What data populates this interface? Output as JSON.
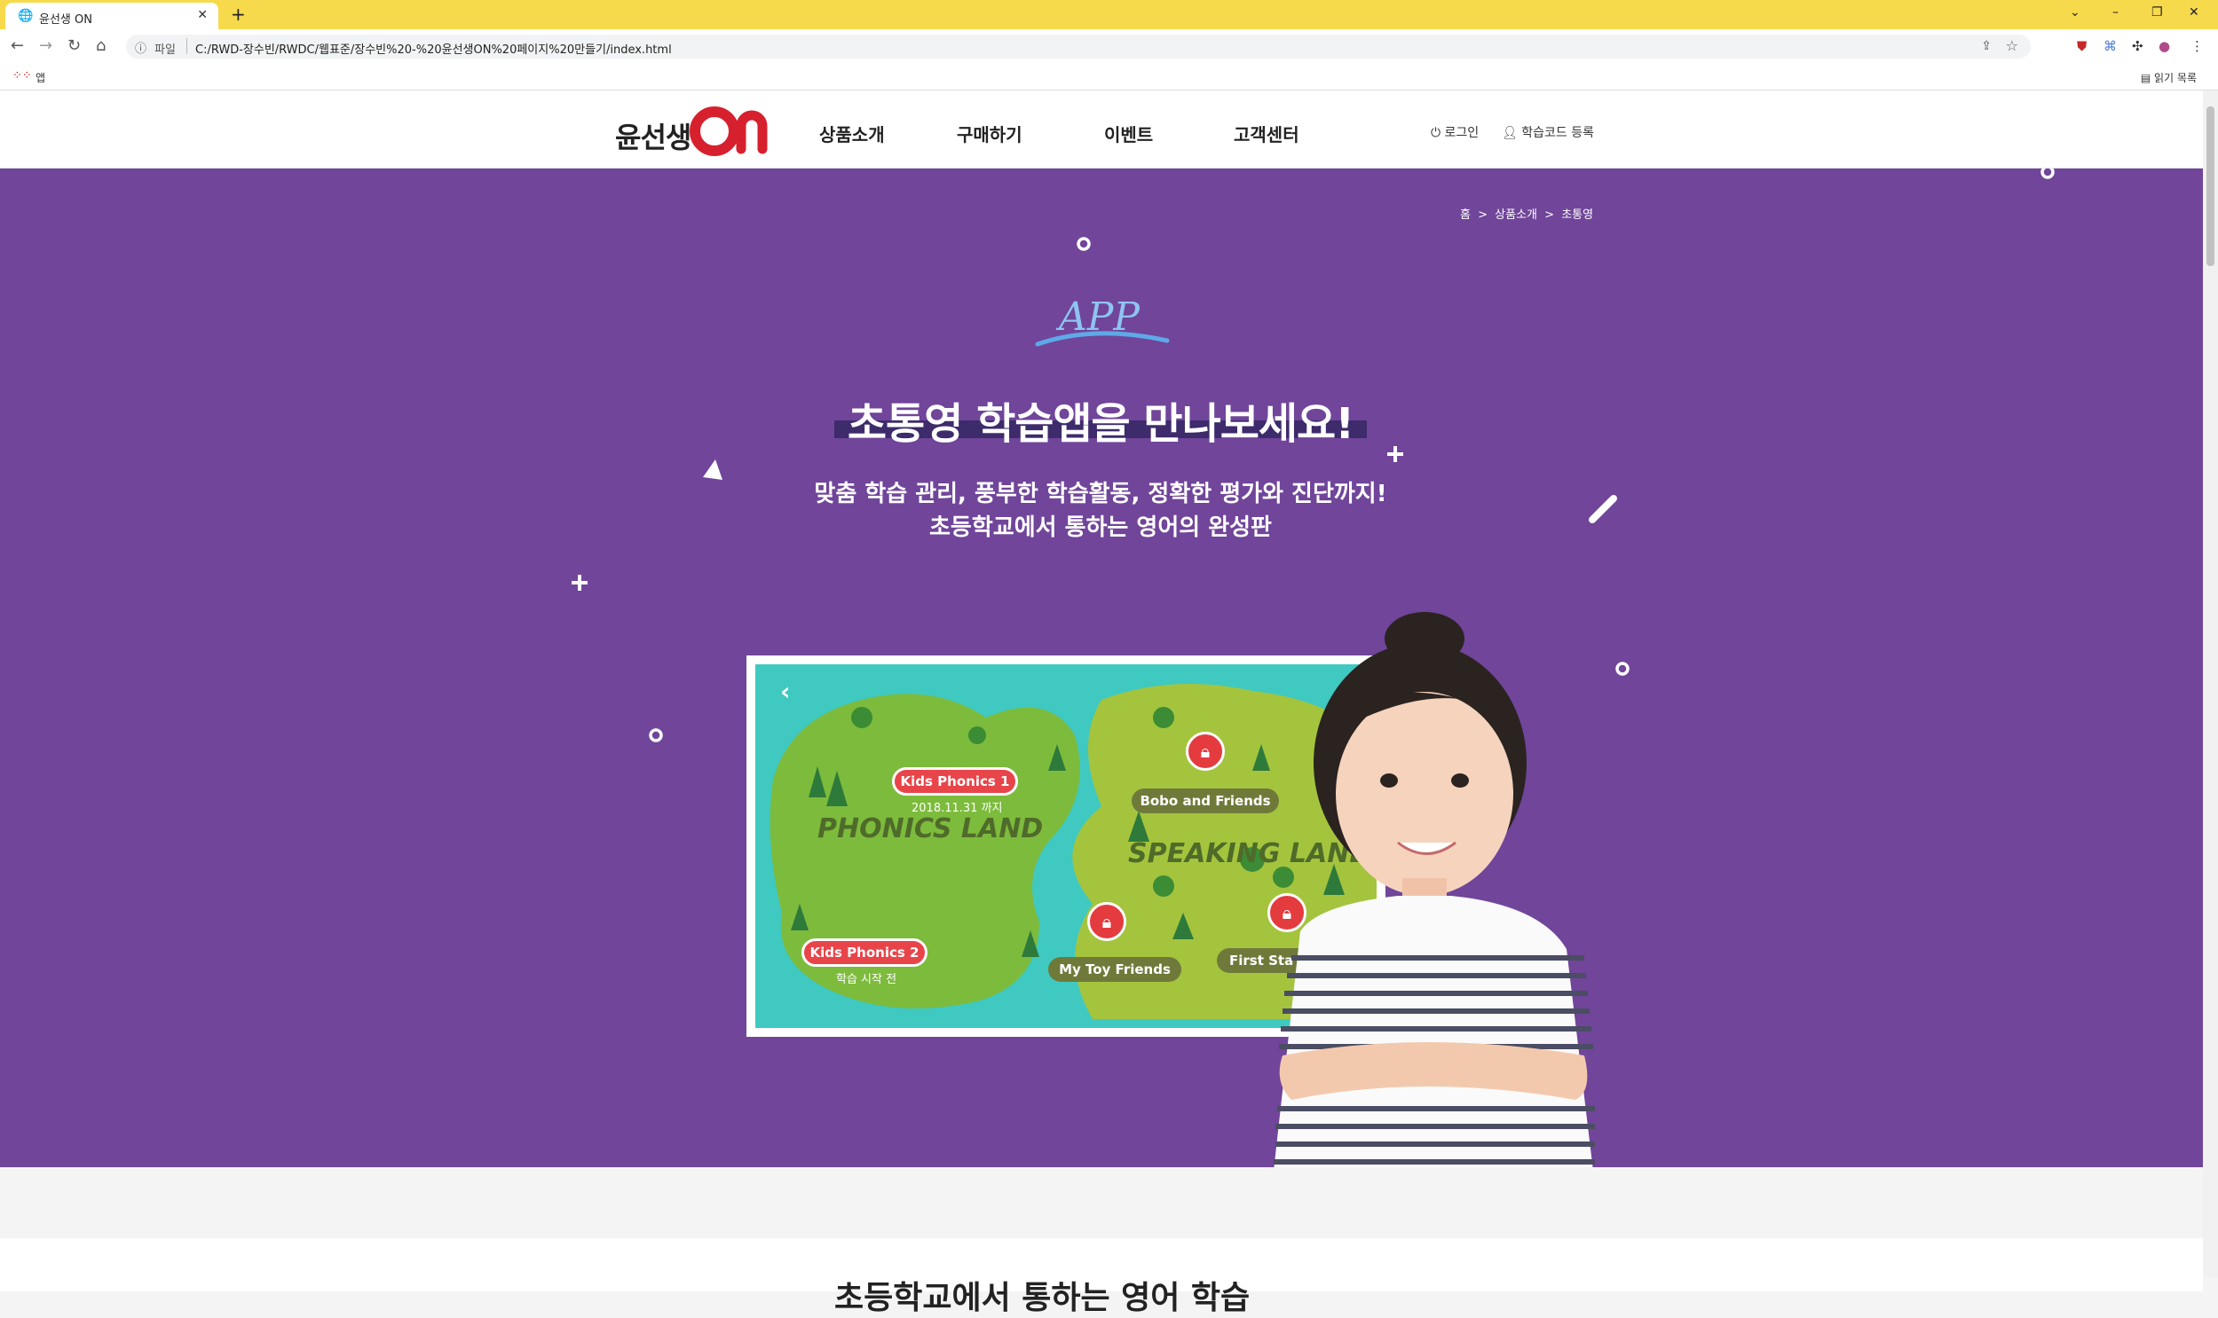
{
  "browser": {
    "tab_title": "윤선생 ON",
    "tab_close": "✕",
    "new_tab": "+",
    "url_scheme_label": "파일",
    "url": "C:/RWD-장수빈/RWDC/웹표준/장수빈%20-%20윤선생ON%20페이지%20만들기/index.html",
    "bookmarks_apps_label": "앱",
    "reading_list_label": "읽기 목록",
    "window_controls": [
      "⌄",
      "–",
      "❐",
      "✕"
    ]
  },
  "header": {
    "logo_text": "윤선생",
    "logo_on": "On",
    "nav": [
      "상품소개",
      "구매하기",
      "이벤트",
      "고객센터"
    ],
    "login": "로그인",
    "register": "학습코드 등록"
  },
  "breadcrumb": [
    "홈",
    ">",
    "상품소개",
    ">",
    "초통영"
  ],
  "hero": {
    "tag": "APP",
    "title": "초통영 학습앱을 만나보세요!",
    "subtitle_line1": "맞춤 학습 관리, 풍부한 학습활동, 정확한 평가와 진단까지!",
    "subtitle_line2": "초등학교에서 통하는 영어의 완성판"
  },
  "app_map": {
    "phonics_land": "PHONICS LAND",
    "speaking_land": "SPEAKING LAND",
    "kids_phonics_1": "Kids Phonics 1",
    "kids_phonics_1_status": "2018.11.31 까지",
    "kids_phonics_2": "Kids Phonics 2",
    "kids_phonics_2_status": "학습 시작 전",
    "bobo": "Bobo and Friends",
    "my_toy": "My Toy Friends",
    "first_star": "First Sta"
  },
  "section2": {
    "title": "초등학교에서 통하는 영어 학습"
  },
  "colors": {
    "hero_bg": "#70459a",
    "brand_red": "#d7202e",
    "tab_bar": "#f7d94c",
    "map_sea": "#3fc9c1",
    "pill_red": "#e8454a"
  }
}
